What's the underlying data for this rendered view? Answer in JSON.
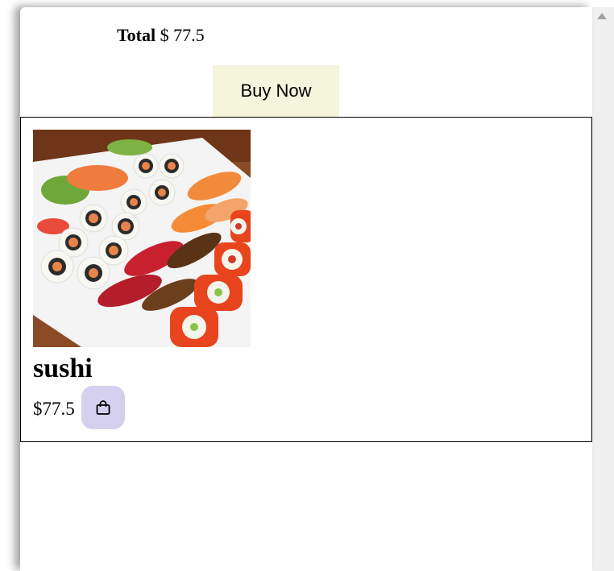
{
  "cart": {
    "total_label": "Total",
    "total_value": "$ 77.5",
    "buy_label": "Buy Now"
  },
  "product": {
    "name": "sushi",
    "price": "$77.5",
    "image_alt": "sushi",
    "cart_icon": "shopping-bag-icon"
  },
  "colors": {
    "buy_button_bg": "#f5f5dc",
    "bag_button_bg": "#d4d0ee",
    "scrollbar_track": "#f0f0f0"
  }
}
